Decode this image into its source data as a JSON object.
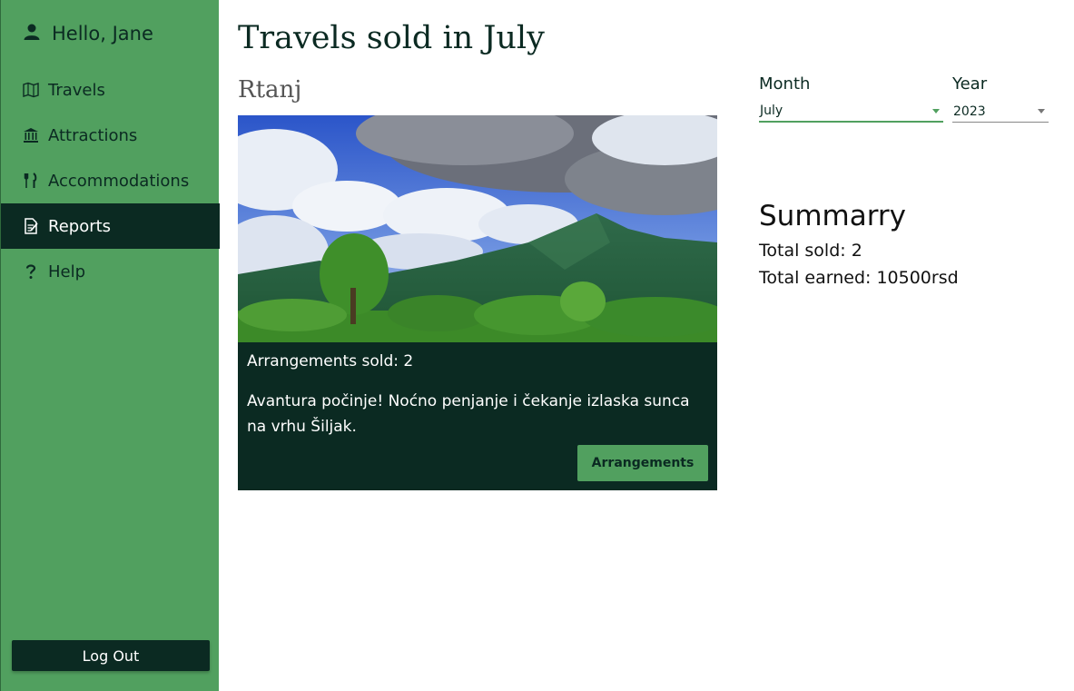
{
  "sidebar": {
    "greeting": "Hello, Jane",
    "items": [
      {
        "label": "Travels",
        "icon": "map-icon"
      },
      {
        "label": "Attractions",
        "icon": "landmark-icon"
      },
      {
        "label": "Accommodations",
        "icon": "utensils-icon"
      },
      {
        "label": "Reports",
        "icon": "report-icon",
        "active": true
      },
      {
        "label": "Help",
        "icon": "question-icon"
      }
    ],
    "logout_label": "Log Out"
  },
  "main": {
    "title": "Travels sold in July",
    "card": {
      "title": "Rtanj",
      "sold_text": "Arrangements sold: 2",
      "description": "Avantura počinje! Noćno penjanje i čekanje izlaska sunca na vrhu Šiljak.",
      "button_label": "Arrangements"
    }
  },
  "filters": {
    "month_label": "Month",
    "month_value": "July",
    "year_label": "Year",
    "year_value": "2023"
  },
  "summary": {
    "title": "Summarry",
    "total_sold": "Total sold: 2",
    "total_earned": "Total earned: 10500rsd"
  },
  "colors": {
    "sidebar_bg": "#51a05f",
    "dark": "#0b2a22",
    "accent": "#51a05f"
  }
}
